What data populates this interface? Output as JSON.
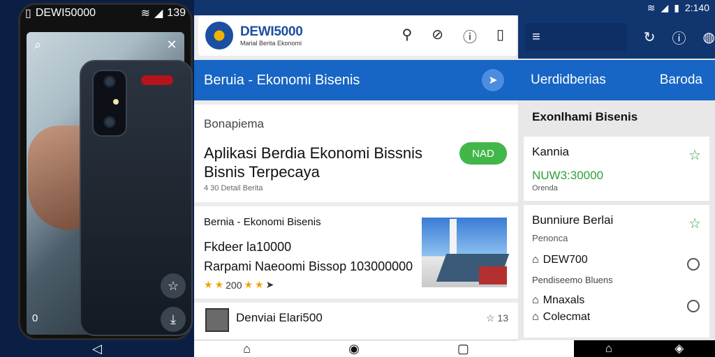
{
  "left": {
    "status": {
      "carrier": "DEWI50000",
      "time": "139"
    },
    "bottom_text": "0",
    "nav_back": "◁"
  },
  "middle": {
    "header": {
      "brand_name": "DEWI5000",
      "brand_sub": "Marial Berita Ekonomi"
    },
    "bar_title": "Beruia - Ekonomi Bisenis",
    "featured": {
      "section": "Bonapiema",
      "headline": "Aplikasi Berdia Ekonomi Bissnis Bisnis Terpecaya",
      "meta": "4 30 Detail Berita",
      "badge": "NAD"
    },
    "article": {
      "title": "Bernia - Ekonomi Bisenis",
      "line1": "Fkdeer la10000",
      "line2": "Rarpami Naeoomi Bissop 103000000",
      "rating_text": "200"
    },
    "list_item": {
      "name": "Denviai Elari500",
      "count": "13"
    }
  },
  "right": {
    "time": "2:140",
    "bar_left": "Uerdidberias",
    "bar_right": "Baroda",
    "section": "Exonlhami Bisenis",
    "card1": {
      "title": "Kannia",
      "value": "NUW3:30000",
      "sub": "Orenda"
    },
    "card2": {
      "title": "Bunniure Berlai",
      "sub": "Penonca",
      "row1": "DEW700",
      "row1_sub": "Pendiseemo Bluens",
      "row2": "Mnaxals",
      "row3": "Colecmat"
    }
  },
  "colors": {
    "primary": "#1765c4",
    "dark": "#11356f",
    "accent_green": "#43b649",
    "star": "#f2a200"
  },
  "icons": [
    "search-icon",
    "close-icon",
    "star-icon",
    "download-icon",
    "back-icon",
    "user-icon",
    "compass-icon",
    "info-icon",
    "phone-icon",
    "menu-icon",
    "pin-icon",
    "refresh-icon",
    "home-icon"
  ]
}
